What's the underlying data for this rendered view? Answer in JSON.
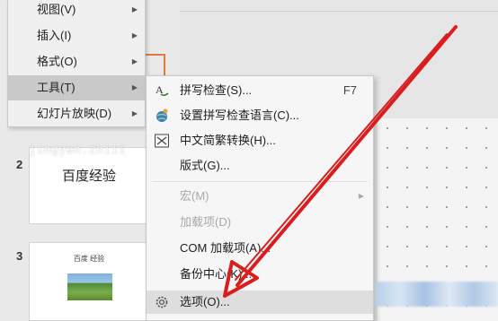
{
  "menu": {
    "items": [
      {
        "label": "视图(V)"
      },
      {
        "label": "插入(I)"
      },
      {
        "label": "格式(O)"
      },
      {
        "label": "工具(T)"
      },
      {
        "label": "幻灯片放映(D)"
      }
    ]
  },
  "submenu": {
    "items": [
      {
        "label": "拼写检查(S)...",
        "shortcut": "F7",
        "icon": "spellcheck-icon"
      },
      {
        "label": "设置拼写检查语言(C)...",
        "icon": "globe-icon"
      },
      {
        "label": "中文简繁转换(H)...",
        "icon": "chinese-convert-icon"
      },
      {
        "label": "版式(G)..."
      },
      {
        "label": "宏(M)"
      },
      {
        "label": "加载项(D)"
      },
      {
        "label": "COM 加载项(A)..."
      },
      {
        "label": "备份中心(K)..."
      },
      {
        "label": "选项(O)...",
        "icon": "gear-icon"
      }
    ]
  },
  "slides": {
    "slide2": {
      "number": "2",
      "title": "百度经验"
    },
    "slide3": {
      "number": "3",
      "title": "百度 经验"
    }
  },
  "watermark": "jingyan.zhiii",
  "colors": {
    "accent_arrow": "#d81e1e",
    "selection_border": "#e47a3a"
  }
}
